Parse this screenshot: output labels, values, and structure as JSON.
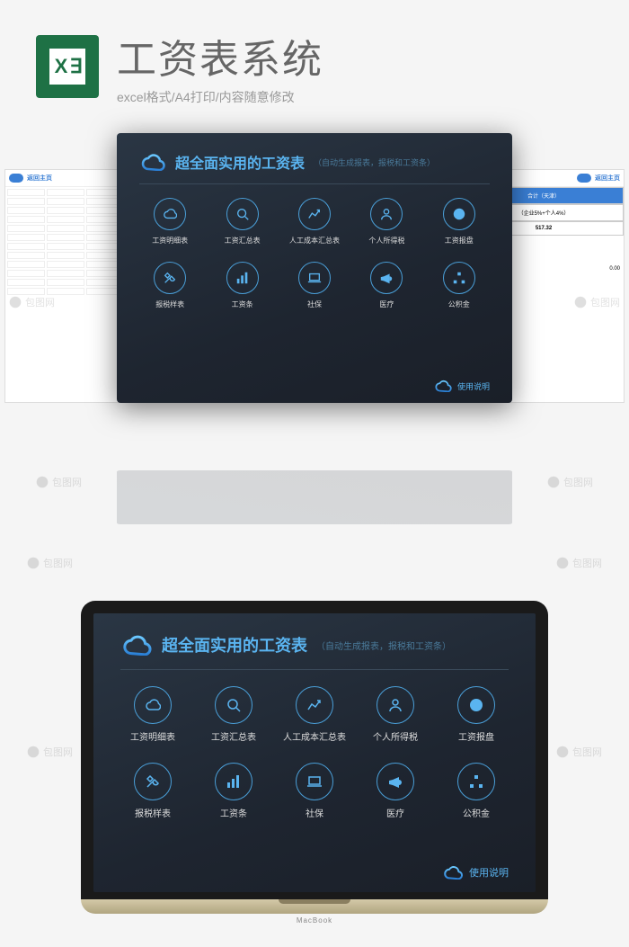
{
  "header": {
    "logo_text": "X ∃",
    "title": "工资表系统",
    "subtitle": "excel格式/A4打印/内容随意修改"
  },
  "panel": {
    "title": "超全面实用的工资表",
    "subtitle": "（自动生成报表，报税和工资条）",
    "footer": "使用说明",
    "items": [
      {
        "label": "工资明细表",
        "icon": "cloud"
      },
      {
        "label": "工资汇总表",
        "icon": "search"
      },
      {
        "label": "人工成本汇总表",
        "icon": "chart-line"
      },
      {
        "label": "个人所得税",
        "icon": "person"
      },
      {
        "label": "工资报盘",
        "icon": "pie"
      },
      {
        "label": "报税样表",
        "icon": "tools"
      },
      {
        "label": "工资条",
        "icon": "bars"
      },
      {
        "label": "社保",
        "icon": "laptop"
      },
      {
        "label": "医疗",
        "icon": "megaphone"
      },
      {
        "label": "公积金",
        "icon": "org"
      }
    ]
  },
  "side_left": {
    "link": "返回主页"
  },
  "side_right": {
    "link": "返回主页",
    "col1": "合计（天津）",
    "col2": "（企业5%+个人4%）",
    "val1": "517.32",
    "val2": "0.00"
  },
  "watermark": "包图网",
  "laptop_brand": "MacBook"
}
